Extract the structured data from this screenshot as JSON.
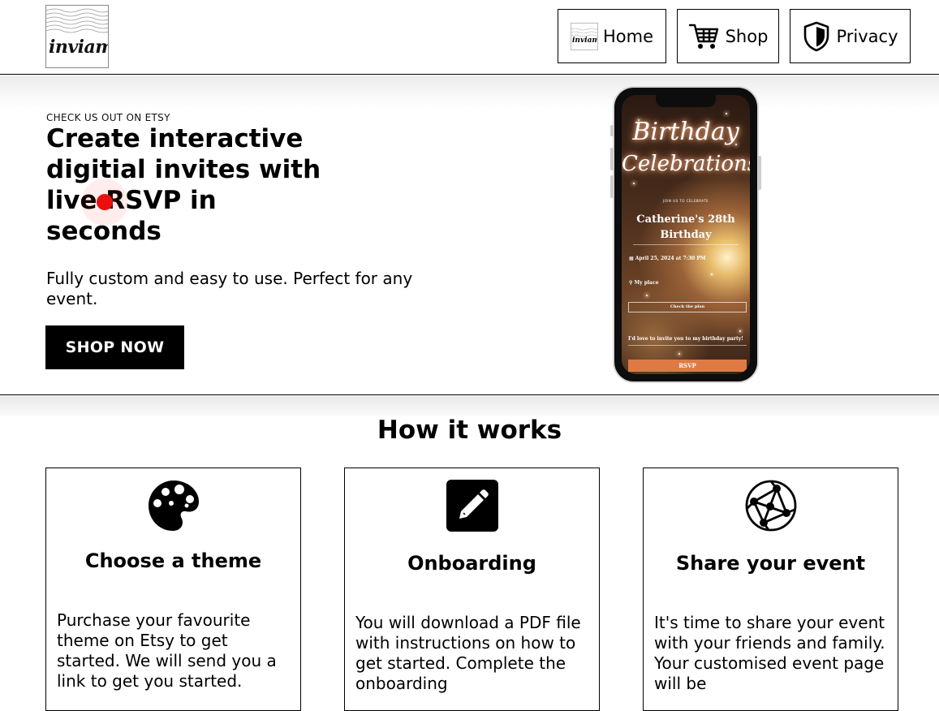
{
  "header": {
    "logo_text": "inviami",
    "nav": [
      {
        "label": "Home",
        "icon": "inviami-logo-icon"
      },
      {
        "label": "Shop",
        "icon": "cart-icon"
      },
      {
        "label": "Privacy",
        "icon": "shield-icon"
      }
    ]
  },
  "hero": {
    "eyebrow": "CHECK US OUT ON ETSY",
    "headline": "Create interactive digitial invites with live RSVP in seconds",
    "subtext": "Fully custom and easy to use. Perfect for any event.",
    "cta_label": "SHOP NOW",
    "phone": {
      "title_line1": "Birthday",
      "title_line2": "Celebrations!",
      "join_text": "JOIN US TO CELEBRATE",
      "event_name": "Catherine's 28th Birthday",
      "date_text": "April 25, 2024 at 7:30 PM",
      "place_text": "My place",
      "check_plan": "Check the plan",
      "message": "I'd love to invite you to my birthday party!",
      "rsvp_label": "RSVP"
    }
  },
  "how_it_works": {
    "title": "How it works",
    "cards": [
      {
        "title": "Choose a theme",
        "icon": "palette-icon",
        "body": "Purchase your favourite theme on Etsy to get started. We will send you a link to get you started."
      },
      {
        "title": "Onboarding",
        "icon": "edit-icon",
        "body": "You will download a PDF file with instructions on how to get started. Complete the onboarding"
      },
      {
        "title": "Share your event",
        "icon": "network-globe-icon",
        "body": "It's time to share your event with your friends and family. Your customised event page will be"
      }
    ]
  },
  "colors": {
    "accent": "#000000",
    "rsvp": "#e07a45",
    "cursor": "#e8110f"
  }
}
